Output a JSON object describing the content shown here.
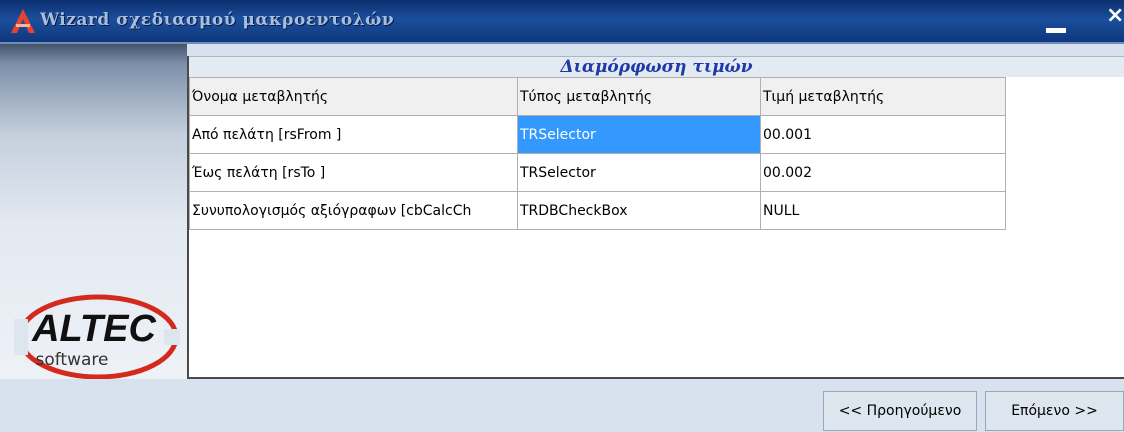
{
  "window": {
    "title": "Wizard σχεδιασμού μακροεντολών",
    "close_glyph": "×"
  },
  "section": {
    "title": "Διαμόρφωση τιμών"
  },
  "table": {
    "headers": [
      "Όνομα μεταβλητής",
      "Τύπος μεταβλητής",
      "Τιμή μεταβλητής"
    ],
    "rows": [
      [
        "Από πελάτη [rsFrom ]",
        "TRSelector",
        "00.001"
      ],
      [
        "Έως πελάτη [rsTo ]",
        "TRSelector",
        "00.002"
      ],
      [
        "Συνυπολογισμός αξιόγραφων [cbCalcCh",
        "TRDBCheckBox",
        "NULL"
      ]
    ],
    "selected_cell": "row 1, column 2"
  },
  "logo": {
    "brand": "ALTEC",
    "tagline": "software"
  },
  "buttons": {
    "prev": "<< Προηγούμενο",
    "next": "Επόμενο >>"
  },
  "colors": {
    "titlebar": "#0f377c",
    "selection": "#3399ff",
    "section_title": "#1c3aa8",
    "logo_red": "#d42a1e"
  },
  "icons": {
    "app": "altec-a-icon",
    "minimize": "minimize-icon",
    "close": "close-icon"
  }
}
